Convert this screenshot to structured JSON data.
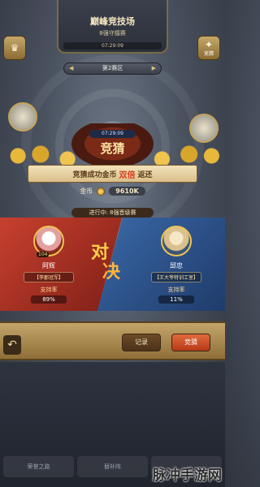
{
  "header": {
    "title": "巅峰竞技场",
    "subtitle": "8强守擂赛",
    "time_label": "07:29:09"
  },
  "side_buttons": {
    "left_label": "",
    "right_label": "竞猜"
  },
  "zone": {
    "value": "第2赛区"
  },
  "guess": {
    "timer": "07:29:09",
    "title": "竞猜",
    "banner_prefix": "竞猜成功金币",
    "banner_highlight": "双倍",
    "banner_suffix": "返还",
    "coin_label": "金币",
    "coin_value": "9610K"
  },
  "stage": {
    "label": "进行中: 8强晋级赛"
  },
  "versus": {
    "text_1": "对",
    "text_2": "决",
    "left": {
      "level": "104",
      "name": "阿辉",
      "guild": "【李郡冠军】",
      "support_label": "支持率",
      "support_value": "89%",
      "support_pct": 89
    },
    "right": {
      "level": "",
      "name": "邱忠",
      "guild": "【王大爷特训工室】",
      "support_label": "支持率",
      "support_value": "11%",
      "support_pct": 11
    }
  },
  "actions": {
    "record": "记录",
    "guess": "竞猜",
    "back_icon": "back-arrow-icon"
  },
  "bottom_tabs": [
    "荣誉之路",
    "替补阵",
    ""
  ],
  "watermark": "脉冲手游网",
  "colors": {
    "red_side": "#c8402e",
    "blue_side": "#3a69a7",
    "gold": "#f0c451"
  }
}
